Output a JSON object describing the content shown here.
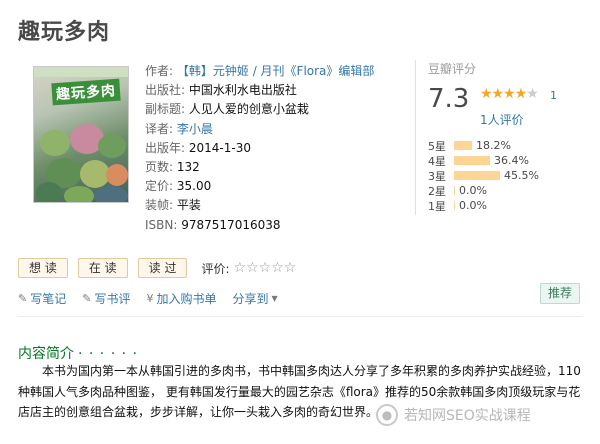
{
  "page": {
    "title": "趣玩多肉"
  },
  "cover": {
    "title_text": "趣玩多肉"
  },
  "info": {
    "author_label": "作者:",
    "author_value": "【韩】元钟姬 / 月刊《Flora》编辑部",
    "publisher_label": "出版社:",
    "publisher_value": "中国水利水电出版社",
    "subtitle_label": "副标题:",
    "subtitle_value": "人见人爱的创意小盆栽",
    "translator_label": "译者:",
    "translator_value": "李小晨",
    "pubdate_label": "出版年:",
    "pubdate_value": "2014-1-30",
    "pages_label": "页数:",
    "pages_value": "132",
    "price_label": "定价:",
    "price_value": "35.00",
    "binding_label": "装帧:",
    "binding_value": "平装",
    "isbn_label": "ISBN:",
    "isbn_value": "9787517016038"
  },
  "rating": {
    "header": "豆瓣评分",
    "score": "7.3",
    "stars_filled": "★★★★",
    "stars_empty": "★",
    "star_num": "1",
    "votes": "1人评价",
    "distribution": [
      {
        "label": "5星",
        "percent": 18.2,
        "text": "18.2%"
      },
      {
        "label": "4星",
        "percent": 36.4,
        "text": "36.4%"
      },
      {
        "label": "3星",
        "percent": 45.5,
        "text": "45.5%"
      },
      {
        "label": "2星",
        "percent": 0.0,
        "text": "0.0%"
      },
      {
        "label": "1星",
        "percent": 0.0,
        "text": "0.0%"
      }
    ]
  },
  "actions": {
    "want_label": "想 读",
    "reading_label": "在 读",
    "read_label": "读 过",
    "evaluate_label": "评价:",
    "empty_stars": "☆☆☆☆☆"
  },
  "links": {
    "note_icon": "pencil-icon",
    "note_label": "写笔记",
    "review_icon": "pencil-icon",
    "review_label": "写书评",
    "cart_icon": "yen-icon",
    "cart_label": "加入购书单",
    "share_label": "分享到",
    "share_arrow": "▼",
    "recommend_label": "推荐"
  },
  "intro": {
    "title": "内容简介",
    "dots": "· · · · · ·",
    "text": "本书为国内第一本从韩国引进的多肉书，书中韩国多肉达人分享了多年积累的多肉养护实战经验，110种韩国人气多肉品种图鉴， 更有韩国发行量最大的园艺杂志《flora》推荐的50余款韩国多肉顶级玩家与花店店主的创意组合盆栽，步步详解，让你一头栽入多肉的奇幻世界。"
  },
  "watermark": {
    "text": "若知网SEO实战课程"
  },
  "colors": {
    "link": "#3377aa",
    "section_green": "#007722",
    "star_orange": "#f5a623",
    "bar_color": "#ffd596"
  }
}
